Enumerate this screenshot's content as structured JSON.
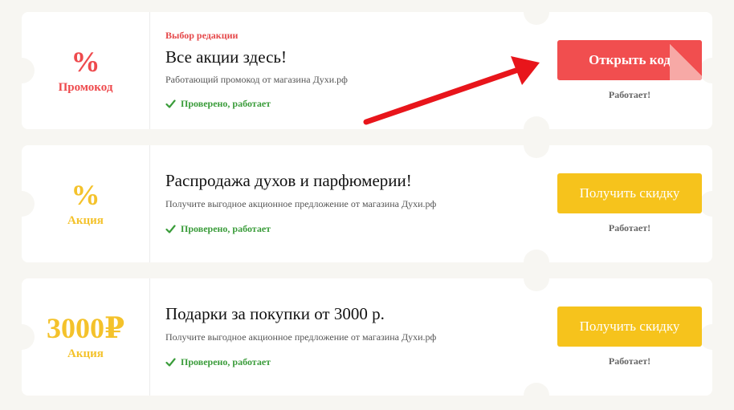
{
  "offers": [
    {
      "badge_value": "%",
      "badge_label": "Промокод",
      "badge_color": "#ee4a4d",
      "editor_pick": "Выбор редакции",
      "title": "Все акции здесь!",
      "description": "Работающий промокод от магазина Духи.рф",
      "verified": "Проверено, работает",
      "button_label": "Открыть код",
      "status": "Работает!"
    },
    {
      "badge_value": "%",
      "badge_label": "Акция",
      "badge_color": "#f4c22b",
      "title": "Распродажа духов и парфюмерии!",
      "description": "Получите выгодное акционное предложение от магазина Духи.рф",
      "verified": "Проверено, работает",
      "button_label": "Получить скидку",
      "status": "Работает!"
    },
    {
      "badge_value": "3000₽",
      "badge_label": "Акция",
      "badge_color": "#f4c22b",
      "title": "Подарки за покупки от 3000 р.",
      "description": "Получите выгодное акционное предложение от магазина Духи.рф",
      "verified": "Проверено, работает",
      "button_label": "Получить скидку",
      "status": "Работает!"
    }
  ],
  "icons": {
    "verified": "check-icon",
    "annotation": "red-arrow-icon"
  },
  "colors": {
    "primary_button": "#f14e4f",
    "secondary_button": "#f6c31c",
    "verified_text": "#3a9c3a",
    "background": "#f7f6f2"
  }
}
